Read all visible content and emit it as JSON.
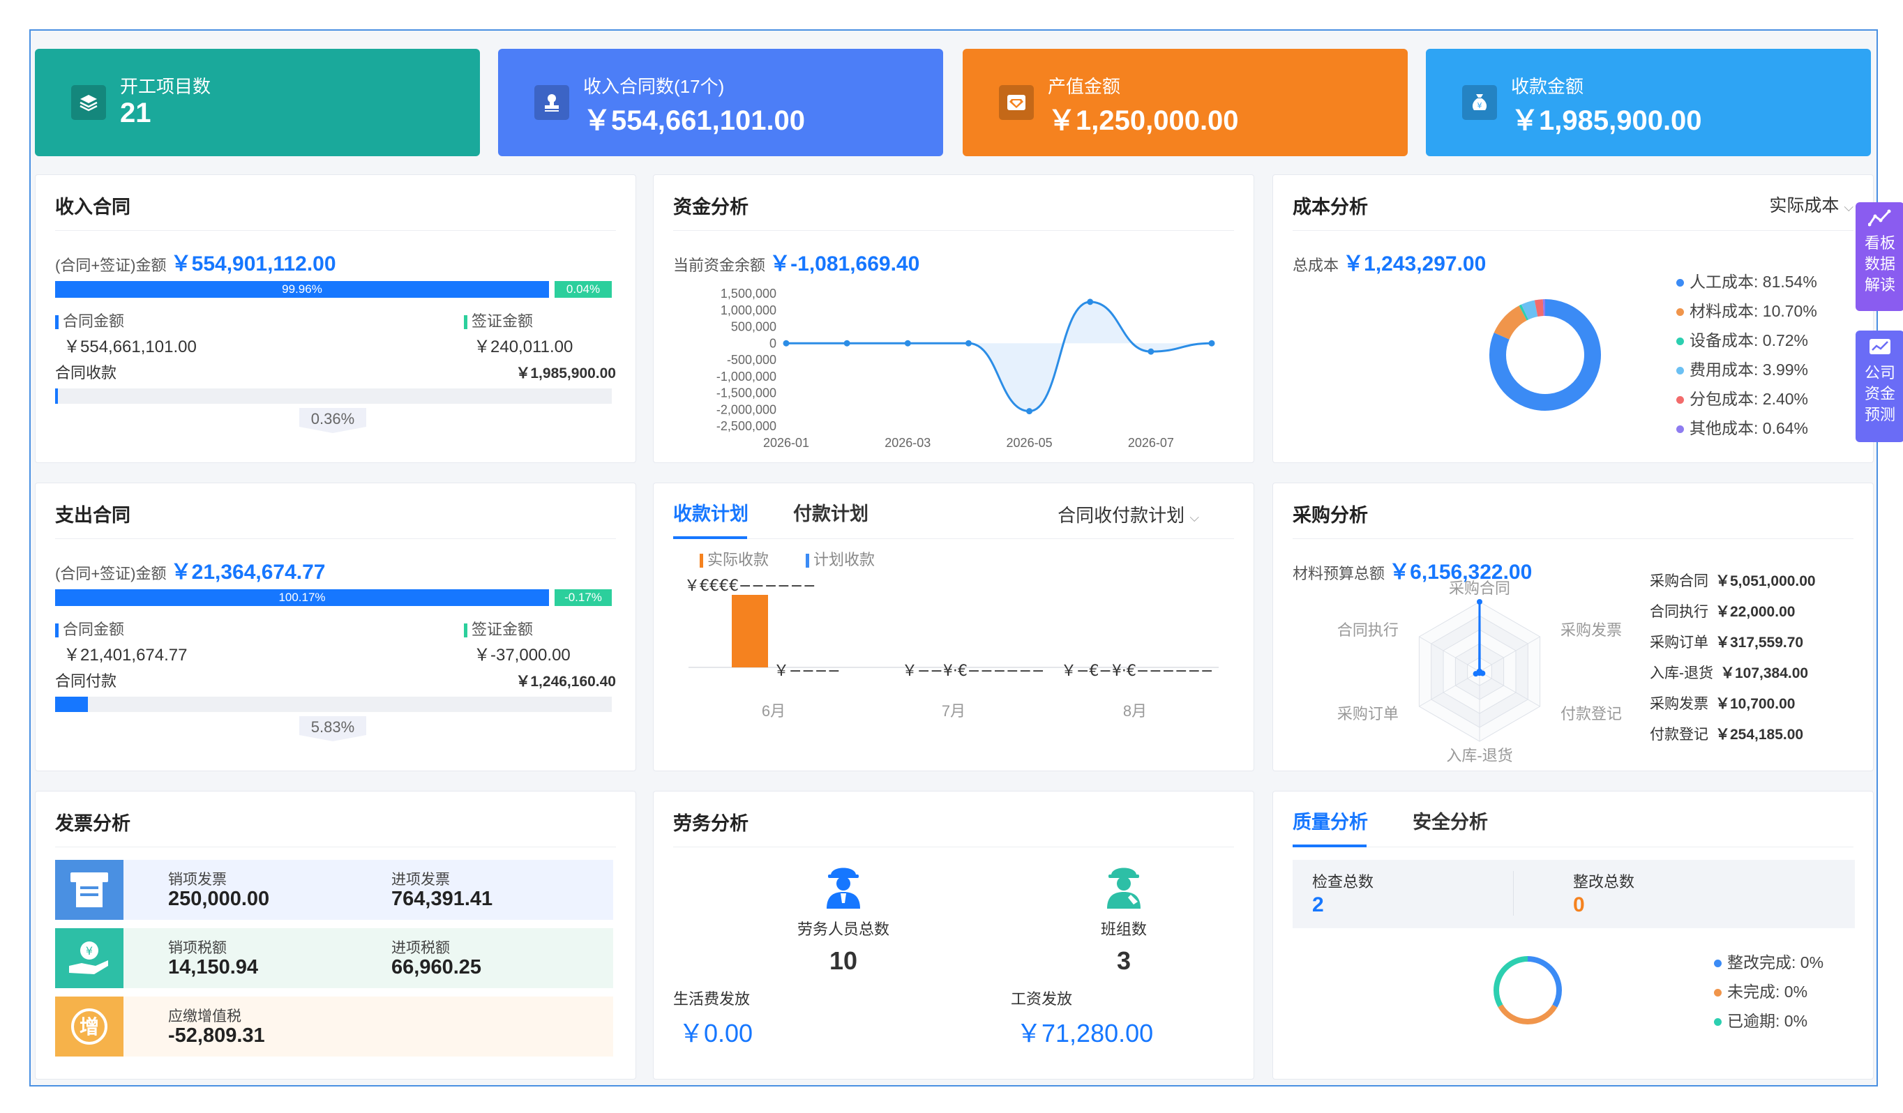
{
  "stats": [
    {
      "label": "开工项目数",
      "value": "21",
      "color": "#1aa99b",
      "icon": "layers-icon"
    },
    {
      "label": "收入合同数(17个)",
      "value": "￥554,661,101.00",
      "color": "#4c7ef7",
      "icon": "stamp-icon"
    },
    {
      "label": "产值金额",
      "value": "￥1,250,000.00",
      "color": "#f5821f",
      "icon": "diamond-icon"
    },
    {
      "label": "收款金额",
      "value": "￥1,985,900.00",
      "color": "#2ea4f4",
      "icon": "money-bag-icon"
    }
  ],
  "income": {
    "title": "收入合同",
    "amount_label": "(合同+签证)金额",
    "amount": "￥554,901,112.00",
    "bar_main_label": "99.96%",
    "bar_main_pct": 99.96,
    "bar_side_label": "0.04%",
    "contract_label": "合同金额",
    "contract_value": "￥554,661,101.00",
    "visa_label": "签证金额",
    "visa_value": "￥240,011.00",
    "collect_label": "合同收款",
    "collect_value": "￥1,985,900.00",
    "collect_pct_label": "0.36%",
    "collect_pct": 0.36
  },
  "expense": {
    "title": "支出合同",
    "amount_label": "(合同+签证)金额",
    "amount": "￥21,364,674.77",
    "bar_main_label": "100.17%",
    "bar_side_label": "-0.17%",
    "contract_label": "合同金额",
    "contract_value": "￥21,401,674.77",
    "visa_label": "签证金额",
    "visa_value": "￥-37,000.00",
    "pay_label": "合同付款",
    "pay_value": "￥1,246,160.40",
    "pay_pct_label": "5.83%",
    "pay_pct": 5.83
  },
  "fund": {
    "title": "资金分析",
    "balance_label": "当前资金余额",
    "balance": "￥-1,081,669.40",
    "chart_data": {
      "type": "line",
      "x": [
        "2026-01",
        "2026-02",
        "2026-03",
        "2026-04",
        "2026-05",
        "2026-06",
        "2026-07",
        "2026-08"
      ],
      "x_tick_labels": [
        "2026-01",
        "2026-03",
        "2026-05",
        "2026-07"
      ],
      "values": [
        0,
        0,
        0,
        0,
        -2050000,
        1250000,
        -250000,
        0
      ],
      "ylim": [
        -2500000,
        1500000
      ],
      "y_ticks": [
        "1,500,000",
        "1,000,000",
        "500,000",
        "0",
        "-500,000",
        "-1,000,000",
        "-1,500,000",
        "-2,000,000",
        "-2,500,000"
      ]
    }
  },
  "cost": {
    "title": "成本分析",
    "dropdown": "实际成本",
    "total_label": "总成本",
    "total": "￥1,243,297.00",
    "chart_data": {
      "type": "pie",
      "labels": [
        "人工成本",
        "材料成本",
        "设备成本",
        "费用成本",
        "分包成本",
        "其他成本"
      ],
      "legend_text": [
        "人工成本: 81.54%",
        "材料成本: 10.70%",
        "设备成本: 0.72%",
        "费用成本: 3.99%",
        "分包成本: 2.40%",
        "其他成本: 0.64%"
      ],
      "values": [
        81.54,
        10.7,
        0.72,
        3.99,
        2.4,
        0.64
      ],
      "colors": [
        "#3b8bf5",
        "#f0954b",
        "#2ccfb0",
        "#6bc0f3",
        "#f26b6b",
        "#8e7cf0"
      ]
    }
  },
  "side_buttons": [
    {
      "label": "看板数据解读",
      "lines": [
        "看板",
        "数据",
        "解读"
      ],
      "color": "#8a5cf0",
      "icon": "trend-icon"
    },
    {
      "label": "公司资金预测",
      "lines": [
        "公司",
        "资金",
        "预测"
      ],
      "color": "#6a6cf6",
      "icon": "forecast-icon"
    }
  ],
  "plan": {
    "tabs": [
      "收款计划",
      "付款计划"
    ],
    "dropdown": "合同收付款计划",
    "legend": [
      "实际收款",
      "计划收款"
    ],
    "chart_data": {
      "type": "bar",
      "categories": [
        "6月",
        "7月",
        "8月"
      ],
      "series": [
        {
          "name": "实际收款",
          "color": "#f5821f"
        },
        {
          "name": "计划收款",
          "color": "#3b8bf5"
        }
      ],
      "actual_labels": [
        "￥€€€€−−−−−−",
        "￥−−¥·€−−−−−−",
        "￥−€−¥·€−−−−−−"
      ],
      "plan_labels": [
        "￥−−−−",
        "",
        ""
      ]
    }
  },
  "purchase": {
    "title": "采购分析",
    "budget_label": "材料预算总额",
    "budget": "￥6,156,322.00",
    "chart_data": {
      "type": "radar",
      "axes": [
        "采购合同",
        "采购发票",
        "付款登记",
        "入库-退货",
        "采购订单",
        "合同执行"
      ],
      "values": [
        5051000,
        10700,
        254185,
        107384,
        317559.7,
        22000
      ]
    },
    "list": [
      {
        "label": "采购合同",
        "value": "￥5,051,000.00"
      },
      {
        "label": "合同执行",
        "value": "￥22,000.00"
      },
      {
        "label": "采购订单",
        "value": "￥317,559.70"
      },
      {
        "label": "入库-退货",
        "value": "￥107,384.00"
      },
      {
        "label": "采购发票",
        "value": "￥10,700.00"
      },
      {
        "label": "付款登记",
        "value": "￥254,185.00"
      }
    ]
  },
  "invoice": {
    "title": "发票分析",
    "rows": [
      {
        "bg": "#eef3ff",
        "tile": "#4a90e2",
        "icon": "invoice-icon",
        "a_label": "销项发票",
        "a_value": "250,000.00",
        "b_label": "进项发票",
        "b_value": "764,391.41"
      },
      {
        "bg": "#edf8f3",
        "tile": "#2dbfa6",
        "icon": "tax-hand-icon",
        "a_label": "销项税额",
        "a_value": "14,150.94",
        "b_label": "进项税额",
        "b_value": "66,960.25"
      },
      {
        "bg": "#fff7ee",
        "tile": "#f6b24a",
        "icon": "vat-icon",
        "a_label": "应缴增值税",
        "a_value": "-52,809.31",
        "b_label": "",
        "b_value": ""
      }
    ]
  },
  "labor": {
    "title": "劳务分析",
    "workers_label": "劳务人员总数",
    "workers": "10",
    "teams_label": "班组数",
    "teams": "3",
    "living_label": "生活费发放",
    "living": "￥0.00",
    "wage_label": "工资发放",
    "wage": "￥71,280.00"
  },
  "quality": {
    "tabs": [
      "质量分析",
      "安全分析"
    ],
    "check_label": "检查总数",
    "check": "2",
    "rectify_label": "整改总数",
    "rectify": "0",
    "chart_data": {
      "type": "pie",
      "labels": [
        "整改完成",
        "未完成",
        "已逾期"
      ],
      "legend_text": [
        "整改完成: 0%",
        "未完成: 0%",
        "已逾期: 0%"
      ],
      "values": [
        0,
        0,
        0
      ],
      "colors": [
        "#3b8bf5",
        "#f0954b",
        "#2ccfb0"
      ]
    }
  }
}
